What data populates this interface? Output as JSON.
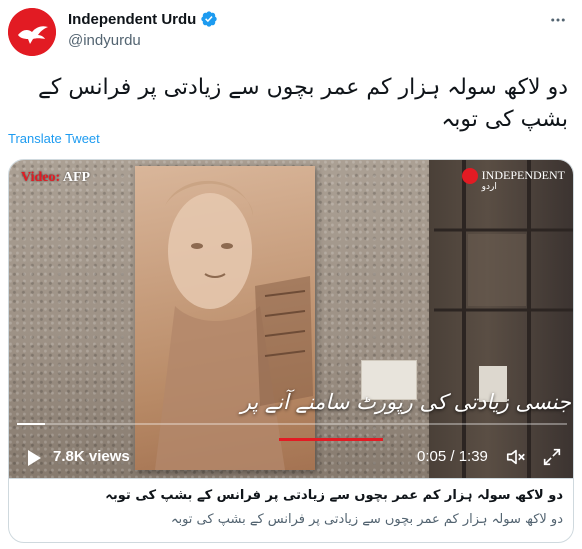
{
  "account": {
    "name": "Independent Urdu",
    "handle": "@indyurdu",
    "verified": true,
    "avatar_color": "#e21b23"
  },
  "tweet": {
    "text": "دو لاکھ سولہ ہزار کم عمر بچوں سے زیادتی پر فرانس کے بشپ کی توبہ",
    "translate_label": "Translate Tweet"
  },
  "video": {
    "credit_prefix": "Video:",
    "credit_source": "AFP",
    "brand_name": "INDEPENDENT",
    "brand_sub": "اردو",
    "overlay_caption": "جنسی زیادتی کی رپورٹ سامنے آنے پر",
    "views": "7.8K views",
    "time": "0:05 / 1:39",
    "progress_fraction": 0.05
  },
  "card": {
    "title": "دو لاکھ سولہ ہزار کم عمر بچوں سے زیادتی پر فرانس کے بشپ کی توبہ",
    "description": "دو لاکھ سولہ ہزار کم عمر بچوں سے زیادتی پر فرانس کے بشپ کی توبہ"
  },
  "icons": {
    "verified": "verified-badge-icon",
    "more": "more-options-icon",
    "play": "play-icon",
    "mute": "volume-muted-icon",
    "fullscreen": "fullscreen-icon"
  },
  "colors": {
    "link": "#1d9bf0",
    "brand_red": "#e21b23"
  }
}
